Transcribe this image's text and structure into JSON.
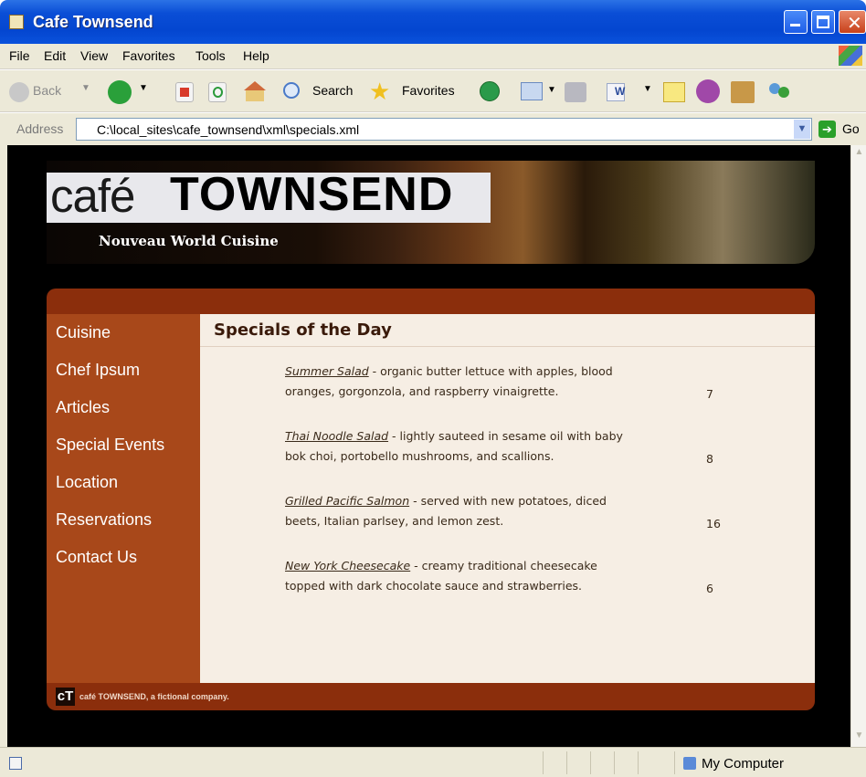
{
  "window": {
    "title": "Cafe Townsend"
  },
  "menu": {
    "items": [
      "File",
      "Edit",
      "View",
      "Favorites",
      "Tools",
      "Help"
    ]
  },
  "toolbar": {
    "back_label": "Back",
    "search_label": "Search",
    "favorites_label": "Favorites"
  },
  "address": {
    "label": "Address",
    "url": "C:\\local_sites\\cafe_townsend\\xml\\specials.xml",
    "go_label": "Go"
  },
  "page": {
    "logo_cafe": "café",
    "logo_townsend": "TOWNSEND",
    "tagline": "Nouveau World Cuisine",
    "nav": [
      "Cuisine",
      "Chef Ipsum",
      "Articles",
      "Special Events",
      "Location",
      "Reservations",
      "Contact Us"
    ],
    "heading": "Specials of the Day",
    "specials": [
      {
        "name": "Summer Salad",
        "line1": " - organic butter lettuce with apples, blood",
        "line2": "oranges, gorgonzola, and raspberry vinaigrette.",
        "price": "7"
      },
      {
        "name": "Thai Noodle Salad",
        "line1": " - lightly sauteed in sesame oil with baby",
        "line2": "bok choi, portobello mushrooms, and scallions.",
        "price": "8"
      },
      {
        "name": "Grilled Pacific Salmon",
        "line1": " - served with new potatoes, diced",
        "line2": "beets, Italian parlsey, and lemon zest.",
        "price": "16"
      },
      {
        "name": "New York Cheesecake",
        "line1": " - creamy traditional cheesecake",
        "line2": "topped with dark chocolate sauce and strawberries.",
        "price": "6"
      }
    ],
    "footer_mark": "cT",
    "footer_text": "café TOWNSEND, a fictional company."
  },
  "status": {
    "zone": "My Computer"
  },
  "colors": {
    "titlebar": "#0446d0",
    "header_band": "#8b2e0c",
    "sidebar": "#a8481a",
    "content_bg": "#f6eee4"
  }
}
